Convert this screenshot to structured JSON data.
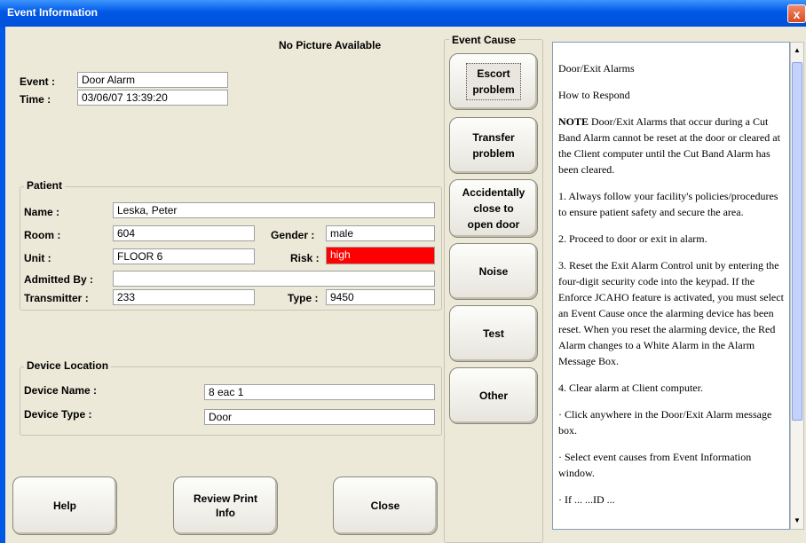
{
  "window": {
    "title": "Event Information",
    "close_label": "x"
  },
  "picture_text": "No Picture Available",
  "event": {
    "label": "Event :",
    "value": "Door Alarm",
    "time_label": "Time :",
    "time_value": "03/06/07 13:39:20"
  },
  "patient": {
    "group_title": "Patient",
    "name_label": "Name :",
    "name_value": "Leska, Peter",
    "room_label": "Room :",
    "room_value": "604",
    "gender_label": "Gender :",
    "gender_value": "male",
    "unit_label": "Unit :",
    "unit_value": "FLOOR 6",
    "risk_label": "Risk :",
    "risk_value": "high",
    "admitted_label": "Admitted By :",
    "admitted_value": "",
    "transmitter_label": "Transmitter :",
    "transmitter_value": "233",
    "type_label": "Type :",
    "type_value": "9450",
    "risk_color": "#ff0000"
  },
  "device": {
    "group_title": "Device Location",
    "name_label": "Device Name :",
    "name_value": "8 eac 1",
    "type_label": "Device Type :",
    "type_value": "Door"
  },
  "buttons": {
    "help": "Help",
    "review_line1": "Review Print",
    "review_line2": "Info",
    "close": "Close"
  },
  "event_cause": {
    "title": "Event Cause",
    "items": [
      {
        "line1": "Escort",
        "line2": "problem",
        "selected": true
      },
      {
        "line1": "Transfer",
        "line2": "problem"
      },
      {
        "line1": "Accidentally",
        "line2": "close to",
        "line3": "open door"
      },
      {
        "line1": "Noise"
      },
      {
        "line1": "Test"
      },
      {
        "line1": "Other"
      }
    ]
  },
  "help_text": {
    "p1": "Door/Exit Alarms",
    "p2": "How to Respond",
    "p3_bold": "NOTE",
    "p3": " Door/Exit Alarms that occur during a Cut Band Alarm cannot be reset at the door or cleared at the Client computer until the Cut Band Alarm has been cleared.",
    "p4": "1. Always follow your facility's policies/procedures to ensure patient safety and secure the area.",
    "p5": "2. Proceed to door or exit in alarm.",
    "p6": "3. Reset the Exit Alarm Control unit by entering the four-digit security code into the keypad. If the Enforce JCAHO feature is activated, you must select an Event Cause once the alarming device has been reset. When you reset the alarming device, the Red Alarm changes to a White Alarm in the Alarm Message Box.",
    "p7": "4. Clear alarm at Client computer.",
    "p8": "· Click anywhere in the Door/Exit Alarm message box.",
    "p9": "· Select event causes from Event Information window.",
    "p10": "· If ... ...ID ..."
  }
}
